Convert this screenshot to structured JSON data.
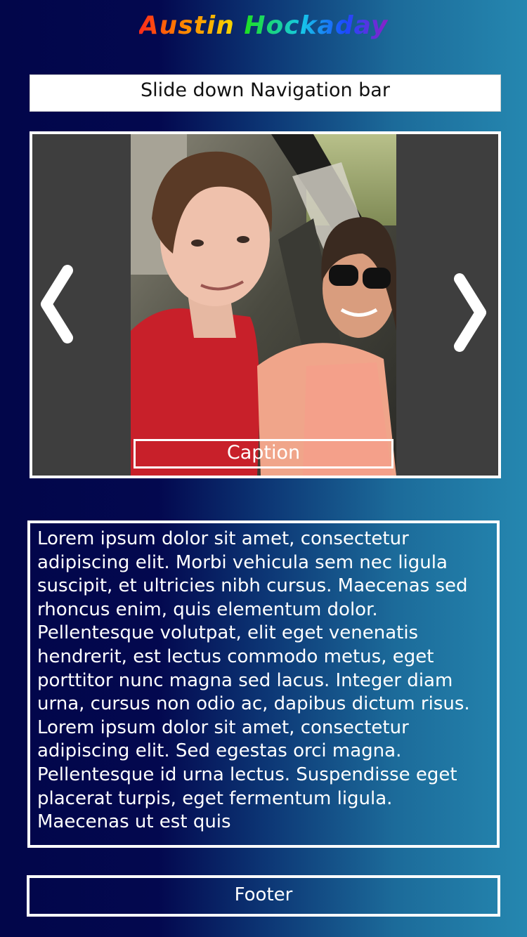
{
  "header": {
    "title_part1": "Austin",
    "title_part2": "Hockaday",
    "colors": [
      "#ff2a1a",
      "#ff8a00",
      "#f5e400",
      "#1ee01e",
      "#16c8e8",
      "#1a4bff",
      "#8b20c8"
    ]
  },
  "nav": {
    "label": "Slide down Navigation bar"
  },
  "carousel": {
    "caption": "Caption",
    "prev_icon": "chevron-left-icon",
    "next_icon": "chevron-right-icon"
  },
  "main": {
    "paragraph": "Lorem ipsum dolor sit amet, consectetur adipiscing elit. Morbi vehicula sem nec ligula suscipit, et ultricies nibh cursus. Maecenas sed rhoncus enim, quis elementum dolor. Pellentesque volutpat, elit eget venenatis hendrerit, est lectus commodo metus, eget porttitor nunc magna sed lacus. Integer diam urna, cursus non odio ac, dapibus dictum risus. Lorem ipsum dolor sit amet, consectetur adipiscing elit. Sed egestas orci magna. Pellentesque id urna lectus. Suspendisse eget placerat turpis, eget fermentum ligula. Maecenas ut est quis"
  },
  "footer": {
    "label": "Footer"
  }
}
